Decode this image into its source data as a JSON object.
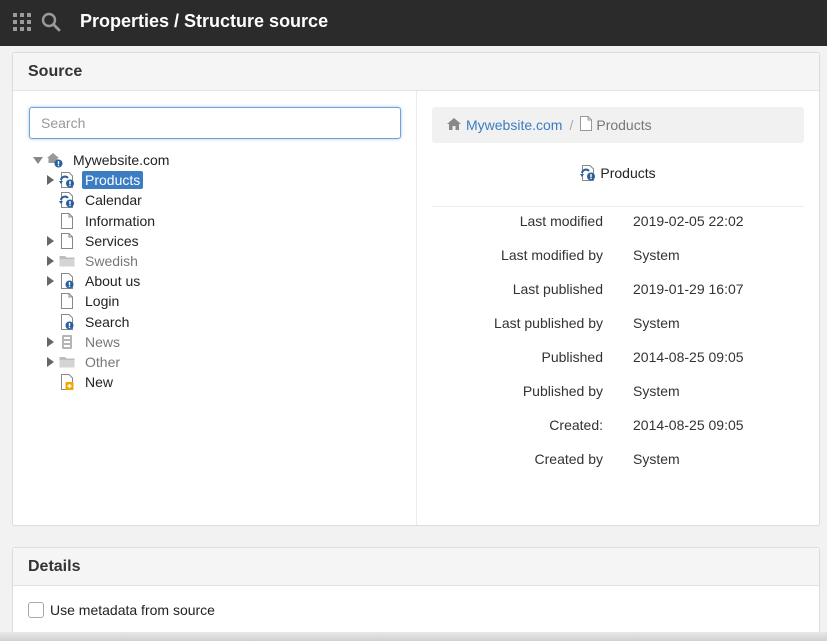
{
  "header": {
    "title": "Properties / Structure source",
    "apps_icon": "grid-icon",
    "search_icon": "search-icon"
  },
  "source_panel": {
    "title": "Source",
    "search": {
      "placeholder": "Search",
      "value": ""
    },
    "tree": [
      {
        "label": "Mywebsite.com",
        "icon": "home-info-icon",
        "expander": "expanded",
        "state": "normal",
        "level": 0
      },
      {
        "label": "Products",
        "icon": "page-reload-info-icon",
        "expander": "collapsed",
        "state": "selected",
        "level": 1
      },
      {
        "label": "Calendar",
        "icon": "page-reload-info-icon",
        "expander": "none",
        "state": "normal",
        "level": 1
      },
      {
        "label": "Information",
        "icon": "page-icon",
        "expander": "none",
        "state": "normal",
        "level": 1
      },
      {
        "label": "Services",
        "icon": "page-icon",
        "expander": "collapsed",
        "state": "normal",
        "level": 1
      },
      {
        "label": "Swedish",
        "icon": "folder-icon",
        "expander": "collapsed",
        "state": "muted",
        "level": 1
      },
      {
        "label": "About us",
        "icon": "page-info-icon",
        "expander": "collapsed",
        "state": "normal",
        "level": 1
      },
      {
        "label": "Login",
        "icon": "page-icon",
        "expander": "none",
        "state": "normal",
        "level": 1
      },
      {
        "label": "Search",
        "icon": "page-info-icon",
        "expander": "none",
        "state": "normal",
        "level": 1
      },
      {
        "label": "News",
        "icon": "archive-icon",
        "expander": "collapsed",
        "state": "muted",
        "level": 1
      },
      {
        "label": "Other",
        "icon": "folder-icon",
        "expander": "collapsed",
        "state": "muted",
        "level": 1
      },
      {
        "label": "New",
        "icon": "page-new-icon",
        "expander": "none",
        "state": "normal",
        "level": 1
      }
    ],
    "breadcrumb": {
      "home_label": "Mywebsite.com",
      "separator": "/",
      "current_label": "Products"
    },
    "detail_title": "Products",
    "properties": [
      {
        "key": "Last modified",
        "value": "2019-02-05 22:02"
      },
      {
        "key": "Last modified by",
        "value": "System"
      },
      {
        "key": "Last published",
        "value": "2019-01-29 16:07"
      },
      {
        "key": "Last published by",
        "value": "System"
      },
      {
        "key": "Published",
        "value": "2014-08-25 09:05"
      },
      {
        "key": "Published by",
        "value": "System"
      },
      {
        "key": "Created:",
        "value": "2014-08-25 09:05"
      },
      {
        "key": "Created by",
        "value": "System"
      }
    ]
  },
  "details_panel": {
    "title": "Details",
    "use_metadata_label": "Use metadata from source",
    "use_metadata_checked": false
  },
  "colors": {
    "topbar": "#2b2b2b",
    "selection": "#3b7cc2",
    "link": "#3b7cc2",
    "info_badge": "#2a5fa0",
    "new_badge": "#f0a800"
  }
}
